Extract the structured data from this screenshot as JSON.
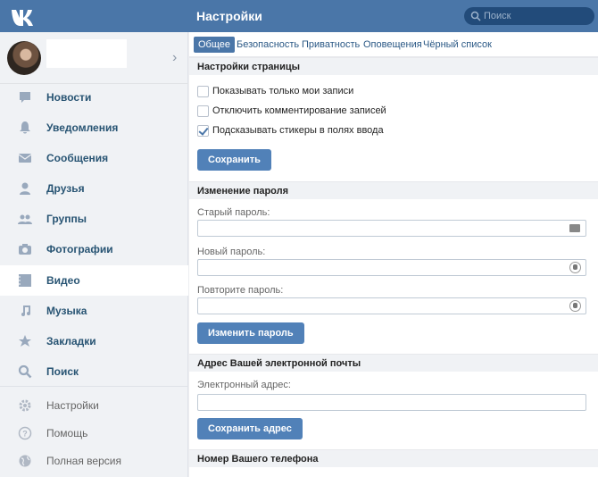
{
  "header": {
    "title": "Настройки",
    "search_placeholder": "Поиск"
  },
  "sidebar": {
    "items": [
      {
        "label": "Новости",
        "icon": "news-icon"
      },
      {
        "label": "Уведомления",
        "icon": "bell-icon"
      },
      {
        "label": "Сообщения",
        "icon": "envelope-icon"
      },
      {
        "label": "Друзья",
        "icon": "person-icon"
      },
      {
        "label": "Группы",
        "icon": "group-icon"
      },
      {
        "label": "Фотографии",
        "icon": "camera-icon"
      },
      {
        "label": "Видео",
        "icon": "film-icon"
      },
      {
        "label": "Музыка",
        "icon": "music-note-icon"
      },
      {
        "label": "Закладки",
        "icon": "star-icon"
      },
      {
        "label": "Поиск",
        "icon": "magnifier-icon"
      }
    ],
    "secondary": [
      {
        "label": "Настройки",
        "icon": "gear-icon"
      },
      {
        "label": "Помощь",
        "icon": "help-icon"
      },
      {
        "label": "Полная версия",
        "icon": "globe-icon"
      }
    ]
  },
  "tabs": [
    "Общее",
    "Безопасность",
    "Приватность",
    "Оповещения",
    "Чёрный список"
  ],
  "page_settings": {
    "title": "Настройки страницы",
    "options": [
      {
        "label": "Показывать только мои записи",
        "checked": false
      },
      {
        "label": "Отключить комментирование записей",
        "checked": false
      },
      {
        "label": "Подсказывать стикеры в полях ввода",
        "checked": true
      }
    ],
    "save_label": "Сохранить"
  },
  "password": {
    "title": "Изменение пароля",
    "old_label": "Старый пароль:",
    "new_label": "Новый пароль:",
    "repeat_label": "Повторите пароль:",
    "button_label": "Изменить пароль"
  },
  "email": {
    "title": "Адрес Вашей электронной почты",
    "label": "Электронный адрес:",
    "button_label": "Сохранить адрес"
  },
  "phone": {
    "title": "Номер Вашего телефона"
  },
  "colors": {
    "accent": "#4a76a8",
    "button": "#5181b8",
    "link": "#2a5885"
  }
}
